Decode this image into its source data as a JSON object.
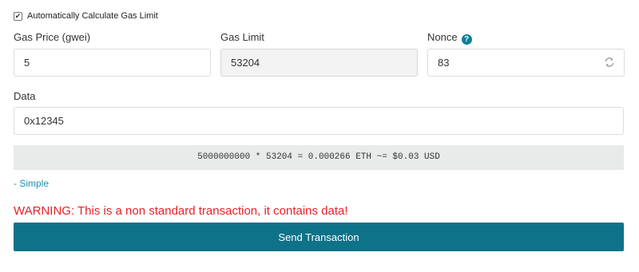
{
  "auto_gas": {
    "label": "Automatically Calculate Gas Limit",
    "checked": true,
    "check_glyph": "✔"
  },
  "fields": {
    "gas_price": {
      "label": "Gas Price (gwei)",
      "value": "5"
    },
    "gas_limit": {
      "label": "Gas Limit",
      "value": "53204"
    },
    "nonce": {
      "label": "Nonce",
      "value": "83",
      "help_glyph": "?",
      "refresh_icon": "refresh-icon"
    },
    "data": {
      "label": "Data",
      "value": "0x12345"
    }
  },
  "calculation": "5000000000 * 53204 = 0.000266 ETH ~= $0.03 USD",
  "simple_link": "- Simple",
  "warning": "WARNING: This is a non standard transaction, it contains data!",
  "send_button": "Send Transaction",
  "colors": {
    "accent": "#0e7289",
    "link": "#1a8fb0",
    "warning": "#e8202a",
    "help_icon": "#0e7f9a"
  }
}
